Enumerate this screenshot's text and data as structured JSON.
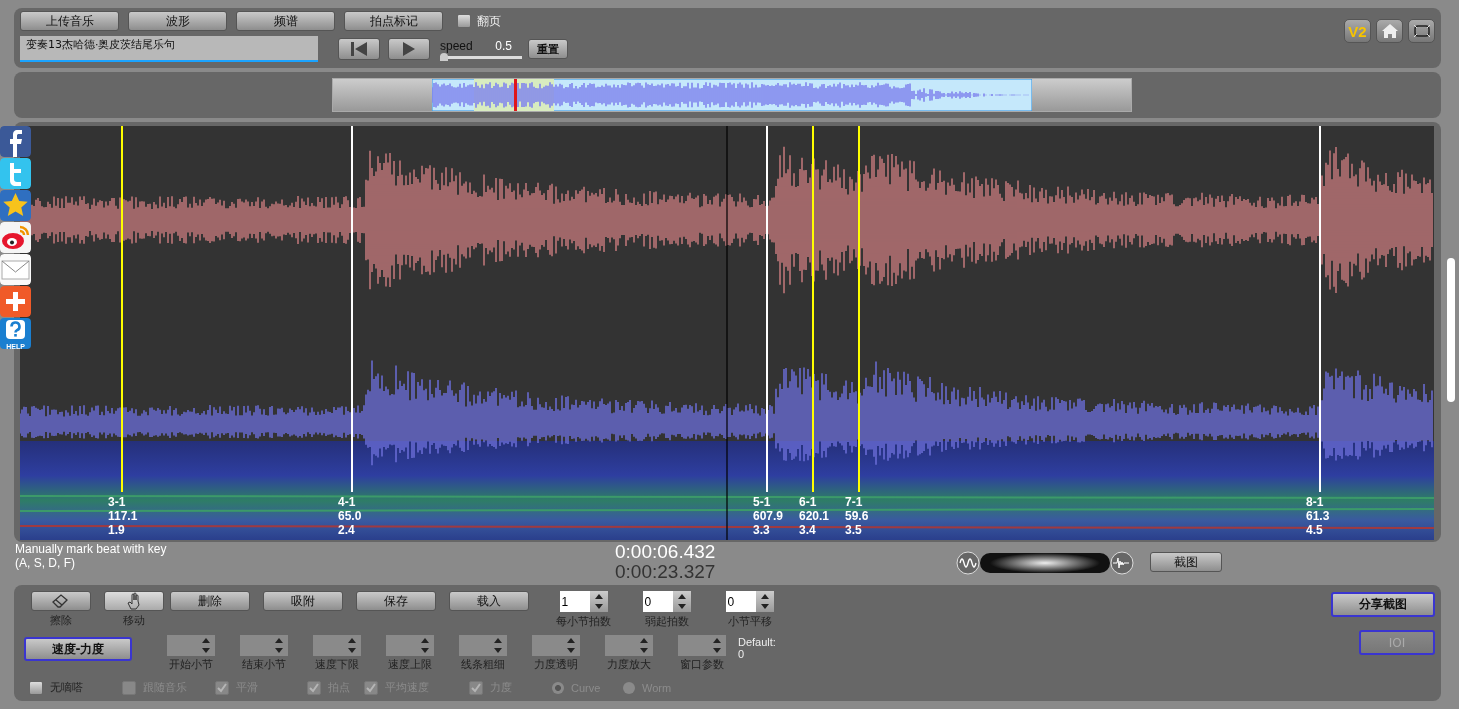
{
  "top_bar": {
    "buttons": [
      "上传音乐",
      "波形",
      "频谱",
      "拍点标记"
    ],
    "page_flip": {
      "label": "翻页",
      "checked": false
    },
    "track_title": "变奏13杰哈德·奥皮茨结尾乐句",
    "speed": {
      "label": "speed",
      "value": "0.5",
      "level": 0.0
    },
    "reset_button": "重置",
    "version_badge": "V2"
  },
  "beat_markers": [
    {
      "bar": "3-1",
      "tempo": "117.1",
      "time": "1.9",
      "color": "#ffff00"
    },
    {
      "bar": "4-1",
      "tempo": "65.0",
      "time": "2.4",
      "color": "#ffffff"
    },
    {
      "bar": "5-1",
      "tempo": "607.9",
      "time": "3.3",
      "color": "#ffffff"
    },
    {
      "bar": "6-1",
      "tempo": "620.1",
      "time": "3.4",
      "color": "#ffff00"
    },
    {
      "bar": "7-1",
      "tempo": "59.6",
      "time": "3.5",
      "color": "#ffff00"
    },
    {
      "bar": "8-1",
      "tempo": "61.3",
      "time": "4.5",
      "color": "#ffffff"
    }
  ],
  "social": {
    "help_label": "HELP"
  },
  "info": {
    "hint_lines": [
      "Manually mark beat with key",
      "(A, S, D, F)"
    ],
    "current_time": "0:00:06.432",
    "total_time": "0:00:23.327",
    "screenshot_button": "截图",
    "view_toggle": {
      "level": 0.5
    }
  },
  "edit_panel": {
    "tools": [
      {
        "label": "擦除",
        "selected": false
      },
      {
        "label": "移动",
        "selected": true
      }
    ],
    "buttons": [
      "删除",
      "吸附",
      "保存",
      "载入"
    ],
    "spinners": [
      {
        "label": "每小节拍数",
        "value": "1"
      },
      {
        "label": "弱起拍数",
        "value": "0"
      },
      {
        "label": "小节平移",
        "value": "0"
      }
    ],
    "share_button": "分享截图",
    "mode_button": "速度-力度",
    "params": [
      {
        "label": "开始小节"
      },
      {
        "label": "结束小节"
      },
      {
        "label": "速度下限"
      },
      {
        "label": "速度上限"
      },
      {
        "label": "线条粗细"
      },
      {
        "label": "力度透明"
      },
      {
        "label": "力度放大"
      },
      {
        "label": "窗口参数"
      }
    ],
    "default_note": [
      "Default:",
      "0"
    ],
    "ioi_button": {
      "label": "IOI",
      "disabled": true
    },
    "options": [
      {
        "kind": "checkbox",
        "label": "无嘀嗒",
        "checked": false,
        "disabled": false
      },
      {
        "kind": "checkbox",
        "label": "跟随音乐",
        "checked": false,
        "disabled": true
      },
      {
        "kind": "checkbox",
        "label": "平滑",
        "checked": true,
        "disabled": true
      },
      {
        "kind": "checkbox",
        "label": "拍点",
        "checked": true,
        "disabled": true
      },
      {
        "kind": "checkbox",
        "label": "平均速度",
        "checked": true,
        "disabled": true
      },
      {
        "kind": "checkbox",
        "label": "力度",
        "checked": true,
        "disabled": true
      },
      {
        "kind": "radio",
        "label": "Curve",
        "selected": true,
        "disabled": true
      },
      {
        "kind": "radio",
        "label": "Worm",
        "selected": false,
        "disabled": true
      }
    ]
  }
}
